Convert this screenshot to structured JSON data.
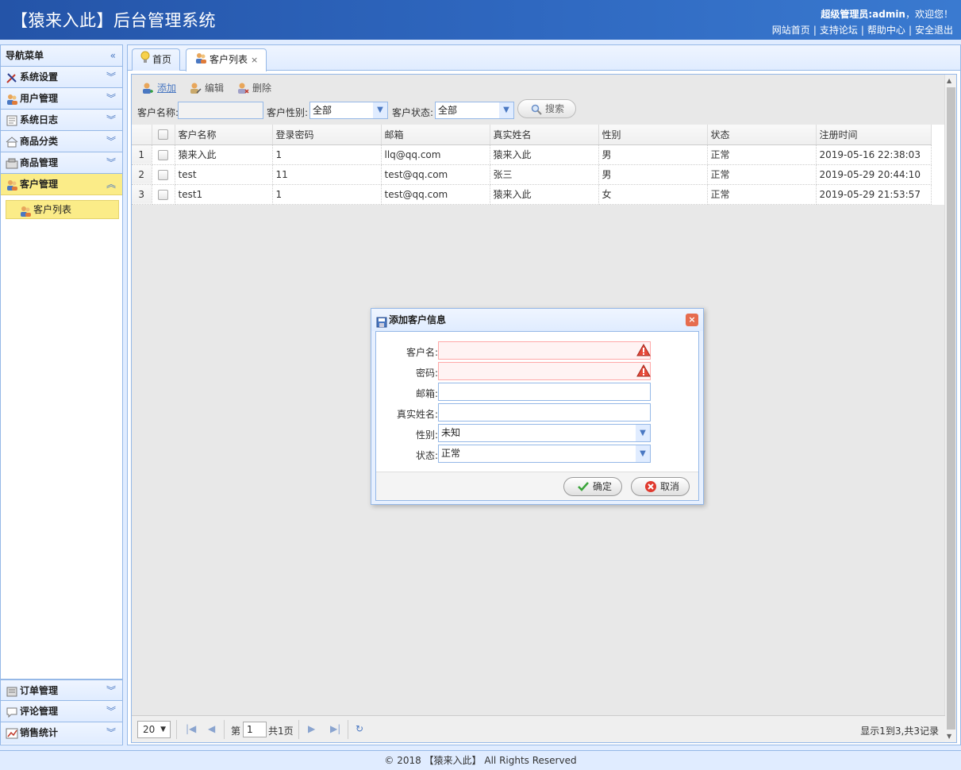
{
  "header": {
    "title": "【猿来入此】后台管理系统",
    "welcome_role": "超级管理员:admin",
    "welcome_rest": "，欢迎您！",
    "links": [
      "网站首页",
      "支持论坛",
      "帮助中心",
      "安全退出"
    ]
  },
  "sidebar": {
    "title": "导航菜单",
    "items": [
      {
        "label": "系统设置",
        "icon": "tools-icon"
      },
      {
        "label": "用户管理",
        "icon": "users-icon"
      },
      {
        "label": "系统日志",
        "icon": "log-icon"
      },
      {
        "label": "商品分类",
        "icon": "category-icon"
      },
      {
        "label": "商品管理",
        "icon": "goods-icon"
      },
      {
        "label": "客户管理",
        "icon": "customers-icon",
        "active": true
      }
    ],
    "sub_items": [
      {
        "label": "客户列表",
        "icon": "customer-list-icon"
      }
    ],
    "bottom_items": [
      {
        "label": "订单管理",
        "icon": "order-icon"
      },
      {
        "label": "评论管理",
        "icon": "comment-icon"
      },
      {
        "label": "销售统计",
        "icon": "chart-icon"
      }
    ]
  },
  "tabs": [
    {
      "label": "首页",
      "icon": "bulb-icon"
    },
    {
      "label": "客户列表",
      "icon": "customer-list-icon",
      "selected": true,
      "closable": true
    }
  ],
  "toolbar": {
    "add": "添加",
    "edit": "编辑",
    "delete": "删除"
  },
  "search": {
    "name_label": "客户名称:",
    "gender_label": "客户性别:",
    "gender_value": "全部",
    "status_label": "客户状态:",
    "status_value": "全部",
    "search_button": "搜索"
  },
  "grid": {
    "columns": [
      "客户名称",
      "登录密码",
      "邮箱",
      "真实姓名",
      "性别",
      "状态",
      "注册时间"
    ],
    "rows": [
      {
        "num": "1",
        "name": "猿来入此",
        "password": "1",
        "email": "llq@qq.com",
        "real_name": "猿来入此",
        "gender": "男",
        "status": "正常",
        "registered": "2019-05-16 22:38:03"
      },
      {
        "num": "2",
        "name": "test",
        "password": "11",
        "email": "test@qq.com",
        "real_name": "张三",
        "gender": "男",
        "status": "正常",
        "registered": "2019-05-29 20:44:10"
      },
      {
        "num": "3",
        "name": "test1",
        "password": "1",
        "email": "test@qq.com",
        "real_name": "猿来入此",
        "gender": "女",
        "status": "正常",
        "registered": "2019-05-29 21:53:57"
      }
    ]
  },
  "pager": {
    "page_size": "20",
    "page_prefix": "第",
    "page_value": "1",
    "page_suffix": "共1页",
    "summary": "显示1到3,共3记录"
  },
  "dialog": {
    "title": "添加客户信息",
    "fields": [
      {
        "label": "客户名:",
        "value": "",
        "invalid": true
      },
      {
        "label": "密码:",
        "value": "",
        "invalid": true
      },
      {
        "label": "邮箱:",
        "value": ""
      },
      {
        "label": "真实姓名:",
        "value": ""
      },
      {
        "label": "性别:",
        "value": "未知",
        "select": true
      },
      {
        "label": "状态:",
        "value": "正常",
        "select": true
      }
    ],
    "ok_button": "确定",
    "cancel_button": "取消"
  },
  "footer": "© 2018 【猿来入此】 All Rights Reserved",
  "colors": {
    "header": "#2454a8",
    "accent": "#95b8e7",
    "active": "#fbec88"
  }
}
